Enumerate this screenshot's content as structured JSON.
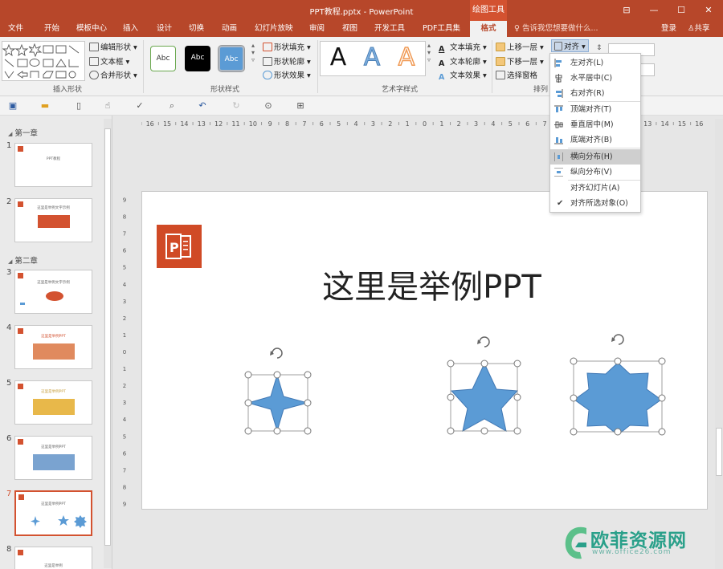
{
  "window": {
    "title": "PPT教程.pptx - PowerPoint",
    "context_tab": "绘图工具",
    "controls": [
      "⊟",
      "—",
      "☐",
      "✕"
    ]
  },
  "tabs": [
    {
      "label": "文件",
      "active": false
    },
    {
      "label": "开始",
      "active": false
    },
    {
      "label": "模板中心",
      "active": false
    },
    {
      "label": "插入",
      "active": false
    },
    {
      "label": "设计",
      "active": false
    },
    {
      "label": "切换",
      "active": false
    },
    {
      "label": "动画",
      "active": false
    },
    {
      "label": "幻灯片放映",
      "active": false
    },
    {
      "label": "审阅",
      "active": false
    },
    {
      "label": "视图",
      "active": false
    },
    {
      "label": "开发工具",
      "active": false
    },
    {
      "label": "PDF工具集",
      "active": false
    },
    {
      "label": "格式",
      "active": true
    }
  ],
  "tell_me": "告诉我您想要做什么...",
  "login_label": "登录",
  "share_label": "共享",
  "ribbon": {
    "insert_shapes": {
      "label": "插入形状",
      "edit_shape": "编辑形状",
      "text_box": "文本框",
      "merge_shapes": "合并形状"
    },
    "shape_styles": {
      "label": "形状样式",
      "samples": [
        "Abc",
        "Abc",
        "Abc"
      ],
      "fill": "形状填充",
      "outline": "形状轮廓",
      "effects": "形状效果"
    },
    "wordart": {
      "label": "艺术字样式",
      "samples": [
        "A",
        "A",
        "A"
      ],
      "text_fill": "文本填充",
      "text_outline": "文本轮廓",
      "text_effects": "文本效果"
    },
    "arrange": {
      "label": "排列",
      "bring_forward": "上移一层",
      "send_backward": "下移一层",
      "selection_pane": "选择窗格",
      "align": "对齐"
    }
  },
  "align_menu": {
    "items": [
      {
        "label": "左对齐(L)",
        "icon": "align-left-icon",
        "highlighted": false
      },
      {
        "label": "水平居中(C)",
        "icon": "align-center-icon",
        "highlighted": false
      },
      {
        "label": "右对齐(R)",
        "icon": "align-right-icon",
        "highlighted": false
      },
      {
        "label": "顶端对齐(T)",
        "icon": "align-top-icon",
        "highlighted": false
      },
      {
        "label": "垂直居中(M)",
        "icon": "align-middle-icon",
        "highlighted": false
      },
      {
        "label": "底端对齐(B)",
        "icon": "align-bottom-icon",
        "highlighted": false
      },
      {
        "label": "横向分布(H)",
        "icon": "distribute-horizontal-icon",
        "highlighted": true
      },
      {
        "label": "纵向分布(V)",
        "icon": "distribute-vertical-icon",
        "highlighted": false
      },
      {
        "label": "对齐幻灯片(A)",
        "icon": "",
        "highlighted": false
      },
      {
        "label": "对齐所选对象(O)",
        "icon": "",
        "highlighted": false,
        "checked": true
      }
    ]
  },
  "ruler_h_labels": [
    "16",
    "15",
    "14",
    "13",
    "12",
    "11",
    "10",
    "9",
    "8",
    "7",
    "6",
    "5",
    "4",
    "3",
    "2",
    "1",
    "0",
    "1",
    "2",
    "3",
    "4",
    "5",
    "6",
    "7",
    "8",
    "9",
    "10",
    "11",
    "12",
    "13",
    "14",
    "15",
    "16"
  ],
  "ruler_v_labels": [
    "9",
    "8",
    "7",
    "6",
    "5",
    "4",
    "3",
    "2",
    "1",
    "0",
    "1",
    "2",
    "3",
    "4",
    "5",
    "6",
    "7",
    "8",
    "9"
  ],
  "sections": [
    {
      "name": "第一章"
    },
    {
      "name": "第二章"
    }
  ],
  "slides": [
    {
      "num": "1",
      "text": "PPT教程"
    },
    {
      "num": "2",
      "text": "这里是举例文字示例"
    },
    {
      "num": "3",
      "text": "这里是举例文字示例"
    },
    {
      "num": "4",
      "text": "这里是举例PPT"
    },
    {
      "num": "5",
      "text": "这里是举例PPT"
    },
    {
      "num": "6",
      "text": "这里是举例PPT"
    },
    {
      "num": "7",
      "text": "这里是举例PPT"
    },
    {
      "num": "8",
      "text": "这里是举例"
    }
  ],
  "slide": {
    "title": "这里是举例PPT"
  },
  "colors": {
    "brand": "#b7472a",
    "shape_fill": "#5b9bd5",
    "shape_stroke": "#4178b4",
    "selected_slide_border": "#d35230"
  },
  "watermark": {
    "text": "欧菲资源网",
    "url": "www.office26.com"
  }
}
